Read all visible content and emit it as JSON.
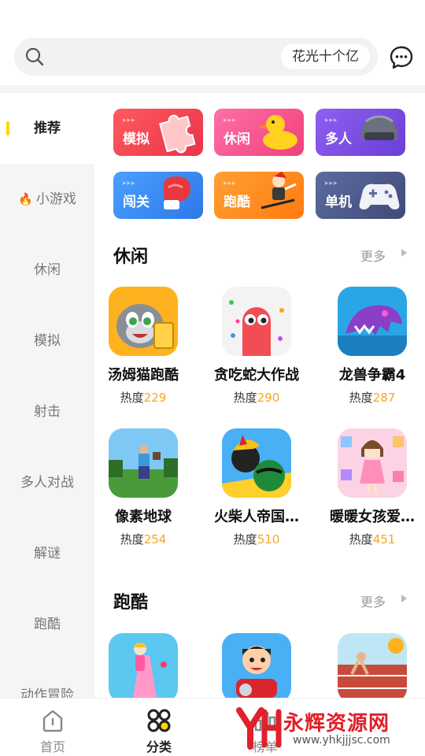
{
  "search": {
    "hint": "花光十个亿"
  },
  "sidebar": {
    "items": [
      {
        "label": "推荐"
      },
      {
        "label": "小游戏"
      },
      {
        "label": "休闲"
      },
      {
        "label": "模拟"
      },
      {
        "label": "射击"
      },
      {
        "label": "多人对战"
      },
      {
        "label": "解谜"
      },
      {
        "label": "跑酷"
      },
      {
        "label": "动作冒险"
      }
    ]
  },
  "categories": [
    {
      "label": "模拟",
      "color": "#f0434c"
    },
    {
      "label": "休闲",
      "color": "#f54b8f"
    },
    {
      "label": "多人",
      "color": "#7c4fe0"
    },
    {
      "label": "闯关",
      "color": "#3b8ef5"
    },
    {
      "label": "跑酷",
      "color": "#ff8a1f"
    },
    {
      "label": "单机",
      "color": "#4f5d8c"
    }
  ],
  "sections": [
    {
      "title": "休闲",
      "more": "更多",
      "games": [
        {
          "name": "汤姆猫跑酷",
          "heat_label": "热度",
          "heat": "229"
        },
        {
          "name": "贪吃蛇大作战",
          "heat_label": "热度",
          "heat": "290"
        },
        {
          "name": "龙兽争霸4",
          "heat_label": "热度",
          "heat": "287"
        },
        {
          "name": "像素地球",
          "heat_label": "热度",
          "heat": "254"
        },
        {
          "name": "火柴人帝国…",
          "heat_label": "热度",
          "heat": "510"
        },
        {
          "name": "暖暖女孩爱…",
          "heat_label": "热度",
          "heat": "451"
        }
      ]
    },
    {
      "title": "跑酷",
      "more": "更多"
    }
  ],
  "tabbar": {
    "items": [
      {
        "label": "首页"
      },
      {
        "label": "分类"
      },
      {
        "label": "榜单"
      }
    ]
  },
  "watermark": {
    "text": "永辉资源网",
    "url": "www.yhkjjjsc.com"
  },
  "colors": {
    "accent": "#ffd600",
    "heat": "#f5a623"
  }
}
